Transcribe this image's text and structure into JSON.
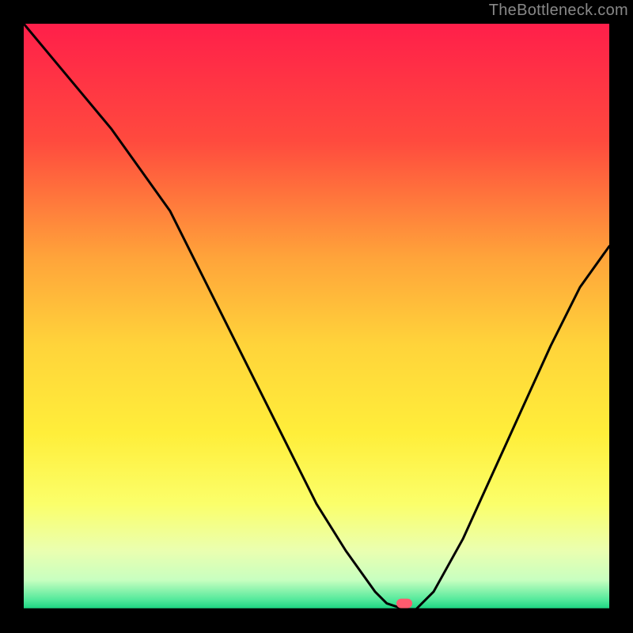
{
  "watermark": "TheBottleneck.com",
  "chart_data": {
    "type": "line",
    "title": "",
    "xlabel": "",
    "ylabel": "",
    "xlim": [
      0,
      100
    ],
    "ylim": [
      0,
      100
    ],
    "x": [
      0,
      5,
      10,
      15,
      20,
      25,
      30,
      35,
      40,
      45,
      50,
      55,
      60,
      62,
      65,
      67,
      70,
      75,
      80,
      85,
      90,
      95,
      100
    ],
    "values": [
      100,
      94,
      88,
      82,
      75,
      68,
      58,
      48,
      38,
      28,
      18,
      10,
      3,
      1,
      0,
      0,
      3,
      12,
      23,
      34,
      45,
      55,
      62
    ],
    "marker": {
      "x": 65,
      "y": 1
    },
    "background_gradient": {
      "stops": [
        {
          "offset": 0.0,
          "color": "#ff1f4a"
        },
        {
          "offset": 0.2,
          "color": "#ff4a3e"
        },
        {
          "offset": 0.4,
          "color": "#ffa43a"
        },
        {
          "offset": 0.55,
          "color": "#ffd43a"
        },
        {
          "offset": 0.7,
          "color": "#ffee3a"
        },
        {
          "offset": 0.82,
          "color": "#fbff6a"
        },
        {
          "offset": 0.9,
          "color": "#eaffb0"
        },
        {
          "offset": 0.95,
          "color": "#c8ffc0"
        },
        {
          "offset": 0.985,
          "color": "#4fe89a"
        },
        {
          "offset": 1.0,
          "color": "#18d480"
        }
      ]
    }
  }
}
